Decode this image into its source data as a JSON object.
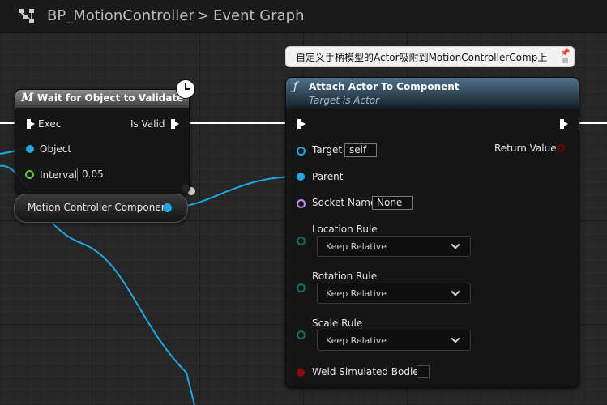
{
  "breadcrumb": {
    "blueprint_name": "BP_MotionController",
    "separator": ">",
    "graph_name": "Event Graph"
  },
  "wait_node": {
    "title": "Wait for Object to Validate",
    "icon": "macro-icon",
    "exec_in_label": "Exec",
    "exec_out_label": "Is Valid",
    "object_label": "Object",
    "interval_label": "Interval",
    "interval_value": "0.05"
  },
  "motion_node": {
    "label": "Motion Controller Component"
  },
  "comment": {
    "text": "自定义手柄模型的Actor吸附到MotionControllerComp上"
  },
  "attach_node": {
    "title": "Attach Actor To Component",
    "subtitle": "Target is Actor",
    "icon": "function-icon",
    "target_label": "Target",
    "target_value": "self",
    "return_label": "Return Value",
    "parent_label": "Parent",
    "socket_label": "Socket Name",
    "socket_value": "None",
    "location_rule_label": "Location Rule",
    "location_rule_value": "Keep Relative",
    "rotation_rule_label": "Rotation Rule",
    "rotation_rule_value": "Keep Relative",
    "scale_rule_label": "Scale Rule",
    "scale_rule_value": "Keep Relative",
    "weld_label": "Weld Simulated Bodies"
  },
  "colors": {
    "exec": "#ffffff",
    "object_pin": "#1fa5e0",
    "float_pin": "#5fc83a",
    "name_pin": "#c68cf0",
    "enum_pin": "#0f6d66",
    "bool_pin": "#8a0c0c",
    "function_header": "#4e718a"
  }
}
